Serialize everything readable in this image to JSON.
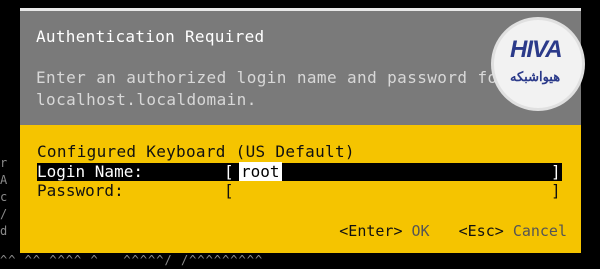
{
  "background": {
    "left_chars": [
      "r",
      "A",
      "c",
      "/",
      "d"
    ],
    "bottom_text": "^^ ^^ ^^^^ ^   ^^^^^/ /^^^^^^^^^"
  },
  "dialog": {
    "title": "Authentication Required",
    "message": "Enter an authorized login name and password for\nlocalhost.localdomain.",
    "keyboard_label": "Configured Keyboard (US Default)",
    "login_label": "Login Name:",
    "login_value": "root",
    "password_label": "Password:",
    "password_value": "",
    "bracket_open": "[",
    "bracket_close": "]",
    "enter_key": "<Enter>",
    "enter_action": "OK",
    "esc_key": "<Esc>",
    "esc_action": "Cancel"
  },
  "logo": {
    "mark": "HIVA",
    "subtitle": "هیواشبکه"
  },
  "colors": {
    "dialog_yellow": "#f5c400",
    "header_gray": "#7a7a7a",
    "selected_row": "#000000"
  }
}
